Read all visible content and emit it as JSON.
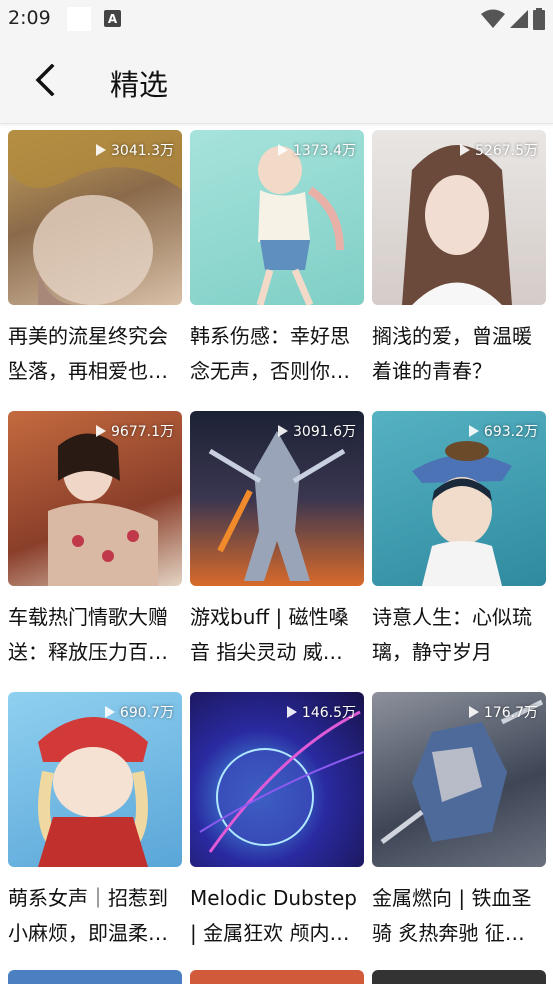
{
  "status_bar": {
    "time": "2:09",
    "a_icon_label": "A"
  },
  "app_bar": {
    "title": "精选"
  },
  "items": [
    {
      "plays": "3041.3万",
      "title": "再美的流星终究会坠落，再相爱也…",
      "bg": "#9c7a5a"
    },
    {
      "plays": "1373.4万",
      "title": "韩系伤感：幸好思念无声，否则你…",
      "bg": "#8fd6cf"
    },
    {
      "plays": "5267.5万",
      "title": "搁浅的爱，曾温暖着谁的青春？",
      "bg": "#d8d2cf"
    },
    {
      "plays": "9677.1万",
      "title": "车载热门情歌大赠送：释放压力百…",
      "bg": "#b86b4a"
    },
    {
      "plays": "3091.6万",
      "title": "游戏buff | 磁性嗓音 指尖灵动 威…",
      "bg": "#3a3f55"
    },
    {
      "plays": "693.2万",
      "title": "诗意人生：心似琉璃，静守岁月",
      "bg": "#4fa8b8"
    },
    {
      "plays": "690.7万",
      "title": "萌系女声｜招惹到小麻烦，即温柔…",
      "bg": "#7cc1e8"
    },
    {
      "plays": "146.5万",
      "title": "Melodic Dubstep | 金属狂欢 颅内…",
      "bg": "#2a2a7a"
    },
    {
      "plays": "176.7万",
      "title": "金属燃向 | 铁血圣骑 炙热奔驰 征…",
      "bg": "#5b6270"
    }
  ],
  "peek_colors": [
    "#4a7fc1",
    "#d05a3a",
    "#333333"
  ]
}
